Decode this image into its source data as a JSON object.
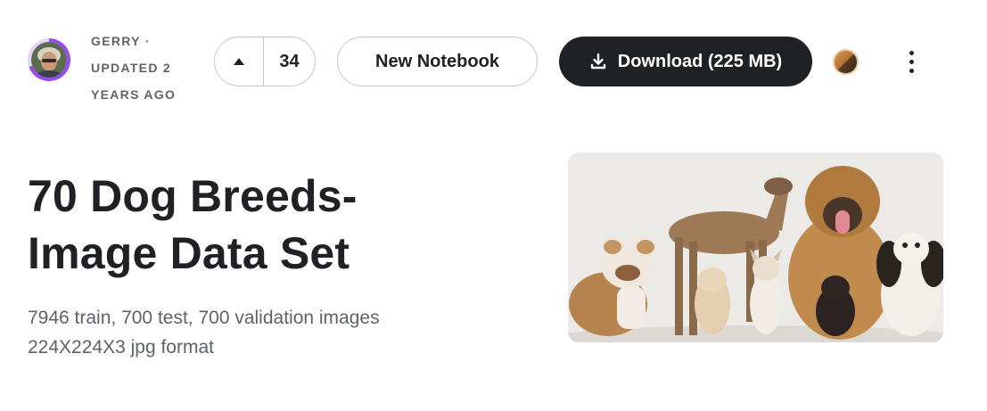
{
  "header": {
    "author": "GERRY ·",
    "updated_line1": "UPDATED 2",
    "updated_line2": "YEARS AGO",
    "upvote_count": "34",
    "new_notebook_label": "New Notebook",
    "download_label": "Download (225 MB)"
  },
  "dataset": {
    "title_line1": "70 Dog Breeds-",
    "title_line2": "Image Data Set",
    "subtitle_line1": "7946 train, 700 test, 700 validation images",
    "subtitle_line2": "224X224X3 jpg format"
  },
  "icons": {
    "upvote": "triangle-up-icon",
    "download": "download-icon",
    "more": "more-vertical-icon"
  },
  "colors": {
    "primary_button": "#202124",
    "avatar_ring": "#9b47f5",
    "text_secondary": "#5f6368"
  }
}
